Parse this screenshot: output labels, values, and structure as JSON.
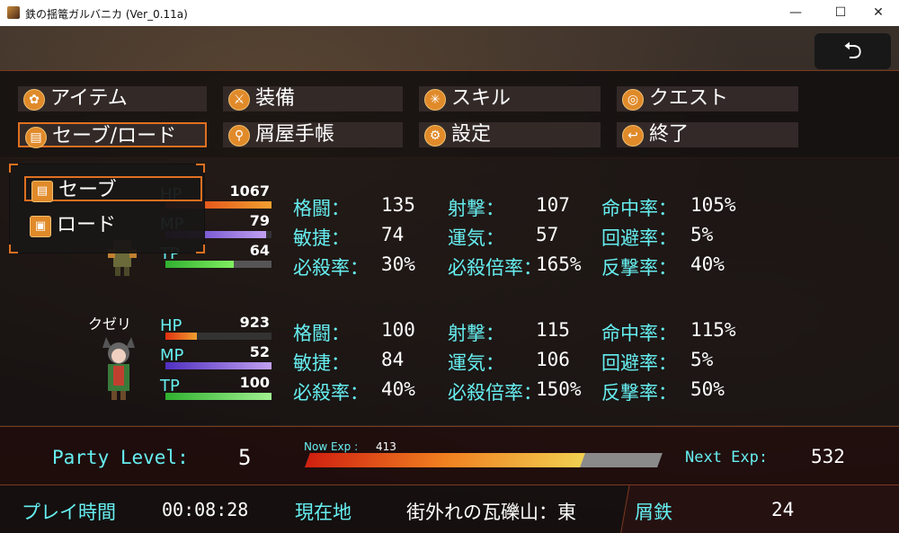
{
  "window": {
    "title": "鉄の揺篭ガルバニカ (Ver_0.11a)",
    "min_icon": "minimize-icon",
    "max_icon": "maximize-icon",
    "close_icon": "close-icon"
  },
  "back_button": {
    "icon": "undo-arrow-icon",
    "glyph": "⮌"
  },
  "commands": [
    {
      "label": "アイテム",
      "icon": "bag-icon"
    },
    {
      "label": "装備",
      "icon": "sword-icon"
    },
    {
      "label": "スキル",
      "icon": "burst-icon"
    },
    {
      "label": "クエスト",
      "icon": "quest-icon"
    },
    {
      "label": "セーブ/ロード",
      "icon": "book-icon"
    },
    {
      "label": "屑屋手帳",
      "icon": "magnifier-icon"
    },
    {
      "label": "設定",
      "icon": "gear-icon"
    },
    {
      "label": "終了",
      "icon": "exit-icon"
    }
  ],
  "submenu": {
    "items": [
      {
        "label": "セーブ",
        "icon": "book-icon"
      },
      {
        "label": "ロード",
        "icon": "box-icon"
      }
    ],
    "selected": 0
  },
  "stat_labels": {
    "hp": "HP",
    "mp": "MP",
    "tp": "TP",
    "kakuto": "格闘：",
    "shageki": "射撃：",
    "meichu": "命中率：",
    "binsho": "敏捷：",
    "unki": "運気：",
    "kaihi": "回避率：",
    "hissatsu": "必殺率：",
    "hissatsu_bai": "必殺倍率：",
    "hangeki": "反撃率："
  },
  "characters": [
    {
      "name": "",
      "hp": "1067",
      "mp": "79",
      "tp": "64",
      "hp_fill": 1.0,
      "mp_fill": 0.95,
      "tp_fill": 0.64,
      "kakuto": "135",
      "shageki": "107",
      "meichu": "105%",
      "binsho": "74",
      "unki": "57",
      "kaihi": "5%",
      "hissatsu": "30%",
      "hissatsu_bai": "165%",
      "hangeki": "40%"
    },
    {
      "name": "クゼリ",
      "hp": "923",
      "mp": "52",
      "tp": "100",
      "hp_fill": 0.3,
      "mp_fill": 1.0,
      "tp_fill": 1.0,
      "kakuto": "100",
      "shageki": "115",
      "meichu": "115%",
      "binsho": "84",
      "unki": "106",
      "kaihi": "5%",
      "hissatsu": "40%",
      "hissatsu_bai": "150%",
      "hangeki": "50%"
    }
  ],
  "party": {
    "level_label": "Party Level:",
    "level": "5",
    "now_exp_label": "Now Exp :",
    "now_exp": "413",
    "next_exp_label": "Next Exp:",
    "next_exp": "532",
    "exp_fill": 0.78
  },
  "status": {
    "playtime_label": "プレイ時間",
    "playtime": "00:08:28",
    "location_label": "現在地",
    "location": "街外れの瓦礫山：東",
    "currency_label": "屑鉄",
    "currency": "24"
  }
}
